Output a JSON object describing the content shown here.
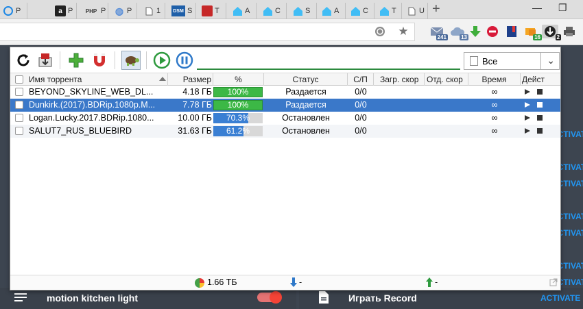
{
  "browser": {
    "tabs": [
      {
        "icon": "google-docs-icon",
        "label": "Р"
      },
      {
        "icon": "amazon-icon",
        "label": "Р"
      },
      {
        "icon": "php-icon",
        "label": "Р"
      },
      {
        "icon": "globe-icon",
        "label": "Р"
      },
      {
        "icon": "document-icon",
        "label": "1"
      },
      {
        "icon": "dsm-icon",
        "label": "S"
      },
      {
        "icon": "app-icon",
        "label": "T"
      },
      {
        "icon": "home-assistant-icon",
        "label": "A"
      },
      {
        "icon": "home-assistant-icon",
        "label": "C"
      },
      {
        "icon": "home-assistant-icon",
        "label": "S"
      },
      {
        "icon": "home-assistant-icon",
        "label": "A"
      },
      {
        "icon": "home-assistant-icon",
        "label": "C"
      },
      {
        "icon": "home-assistant-icon",
        "label": "T"
      },
      {
        "icon": "document-icon",
        "label": "U"
      }
    ],
    "new_tab": "+",
    "window_min": "—",
    "window_max": "❐",
    "extension_badges": {
      "mail": "241",
      "cloud": "13",
      "orders": "16",
      "torrent": "2"
    }
  },
  "background_page": {
    "items": [
      "ACTIVATE",
      "ACTIVATE",
      "ACTIVATE",
      "ACTIVATE",
      "ACTIVATE",
      "ACTIVATE",
      "ACTIVATE"
    ],
    "bottom_left_label": "motion kitchen light",
    "bottom_right_label": "Играть Record",
    "bottom_action": "ACTIVATE",
    "toggle_on": true
  },
  "torrent_popup": {
    "filter_value": "",
    "category_select": "Все",
    "columns": {
      "name": "Имя торрента",
      "size": "Размер",
      "percent": "%",
      "status": "Статус",
      "seeds_peers": "С/П",
      "download_speed": "Загр. скор",
      "upload_speed": "Отд. скор",
      "time": "Время",
      "actions": "Дейст"
    },
    "rows": [
      {
        "name": "BEYOND_SKYLINE_WEB_DL...",
        "size": "4.18 ГБ",
        "progress": 100,
        "progress_label": "100%",
        "status": "Раздается",
        "sp": "0/0",
        "time": "∞",
        "state": "seeding"
      },
      {
        "name": "Dunkirk.(2017).BDRip.1080p.M...",
        "size": "7.78 ГБ",
        "progress": 100,
        "progress_label": "100%",
        "status": "Раздается",
        "sp": "0/0",
        "time": "∞",
        "state": "seeding"
      },
      {
        "name": "Logan.Lucky.2017.BDRip.1080...",
        "size": "10.00 ГБ",
        "progress": 70.3,
        "progress_label": "70.3%",
        "status": "Остановлен",
        "sp": "0/0",
        "time": "∞",
        "state": "stopped"
      },
      {
        "name": "SALUT7_RUS_BLUEBIRD",
        "size": "31.63 ГБ",
        "progress": 61.2,
        "progress_label": "61.2%",
        "status": "Остановлен",
        "sp": "0/0",
        "time": "∞",
        "state": "stopped"
      }
    ],
    "footer": {
      "total_size": "1.66 ТБ",
      "download": "-",
      "upload": "-"
    }
  }
}
